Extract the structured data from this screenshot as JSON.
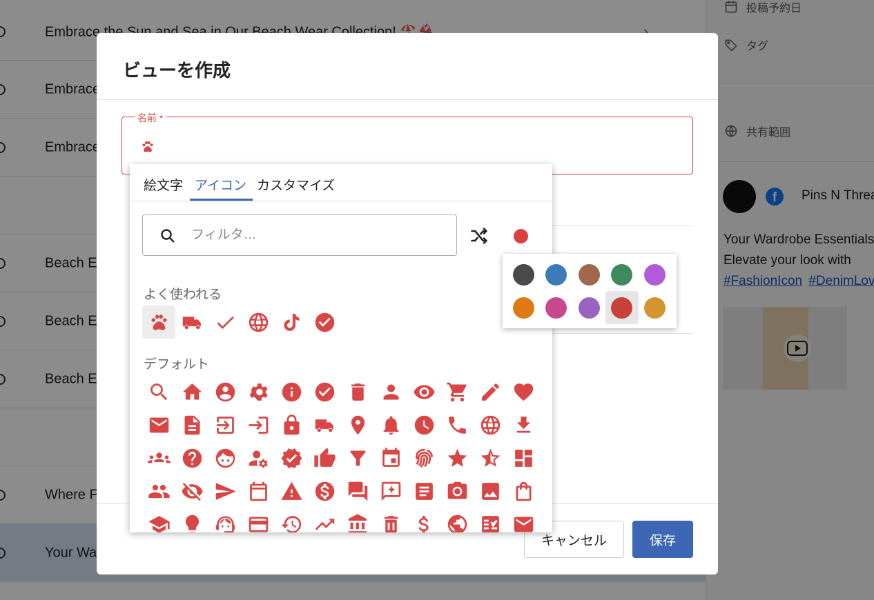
{
  "background": {
    "rows": [
      {
        "text": "Embrace the Sun and Sea in Our Beach Wear Collection! 🏖️👙",
        "chevron": "›"
      },
      {
        "text": "Embrace the Sun and Sea"
      },
      {
        "text": "Embrace the Sun and Sea"
      },
      {
        "text": ""
      },
      {
        "text": "Beach Essentials"
      },
      {
        "text": "Beach Essentials"
      },
      {
        "text": "Beach Essentials"
      },
      {
        "text": ""
      },
      {
        "text": "Where Fashion Meets"
      },
      {
        "text": "Your Wardrobe Essentials"
      }
    ],
    "sidebar": {
      "schedule_label": "投稿予約日",
      "tags_label": "タグ",
      "scope_label": "共有範囲",
      "account_name": "Pins N Threads",
      "fb_letter": "f",
      "post_line1": "Your Wardrobe Essentials",
      "post_line2": "Elevate your look with",
      "hashtag1": "#FashionIcon",
      "hashtag2": "#DenimLove"
    }
  },
  "dialog": {
    "title": "ビューを作成",
    "name_label": "名前 *",
    "name_icon": "paw-icon",
    "cancel_label": "キャンセル",
    "save_label": "保存"
  },
  "picker": {
    "tabs": [
      "絵文字",
      "アイコン",
      "カスタマイズ"
    ],
    "active_tab": "アイコン",
    "filter_placeholder": "フィルタ…",
    "selected_color": "#d94040",
    "icon_color": "#d84646",
    "frequent_title": "よく使われる",
    "default_title": "デフォルト",
    "frequent_icons": [
      "paw-icon",
      "truck-icon",
      "check-icon",
      "globe-icon",
      "tiktok-icon",
      "check-circle-icon"
    ],
    "default_icons": [
      "search-icon",
      "home-icon",
      "account-circle-icon",
      "gear-icon",
      "info-icon",
      "check-circle-icon",
      "trash-icon",
      "person-icon",
      "eye-icon",
      "cart-icon",
      "pencil-icon",
      "heart-icon",
      "mail-icon",
      "document-icon",
      "logout-icon",
      "login-icon",
      "lock-icon",
      "truck-icon",
      "location-pin-icon",
      "bell-icon",
      "clock-icon",
      "phone-icon",
      "globe-icon",
      "download-icon",
      "groups-icon",
      "help-icon",
      "face-icon",
      "manage-accounts-icon",
      "verified-icon",
      "thumb-up-icon",
      "filter-icon",
      "event-icon",
      "fingerprint-icon",
      "star-icon",
      "star-half-icon",
      "dashboard-icon",
      "people-icon",
      "visibility-off-icon",
      "send-icon",
      "calendar-icon",
      "warning-icon",
      "dollar-circle-icon",
      "forum-icon",
      "reviews-icon",
      "article-icon",
      "camera-icon",
      "image-icon",
      "shopping-bag-icon",
      "school-icon",
      "lightbulb-icon",
      "support-agent-icon",
      "credit-card-icon",
      "history-icon",
      "trending-up-icon",
      "bank-icon",
      "delete-icon",
      "dollar-icon",
      "public-icon",
      "checklist-icon",
      "envelope-icon"
    ],
    "palette": [
      "#4a4a4a",
      "#3a7bb8",
      "#a0694e",
      "#3f8a5c",
      "#b25bd9",
      "#df7a12",
      "#c8488e",
      "#9b63c0",
      "#c8403a",
      "#d4942e"
    ],
    "selected_swatch": 8
  }
}
